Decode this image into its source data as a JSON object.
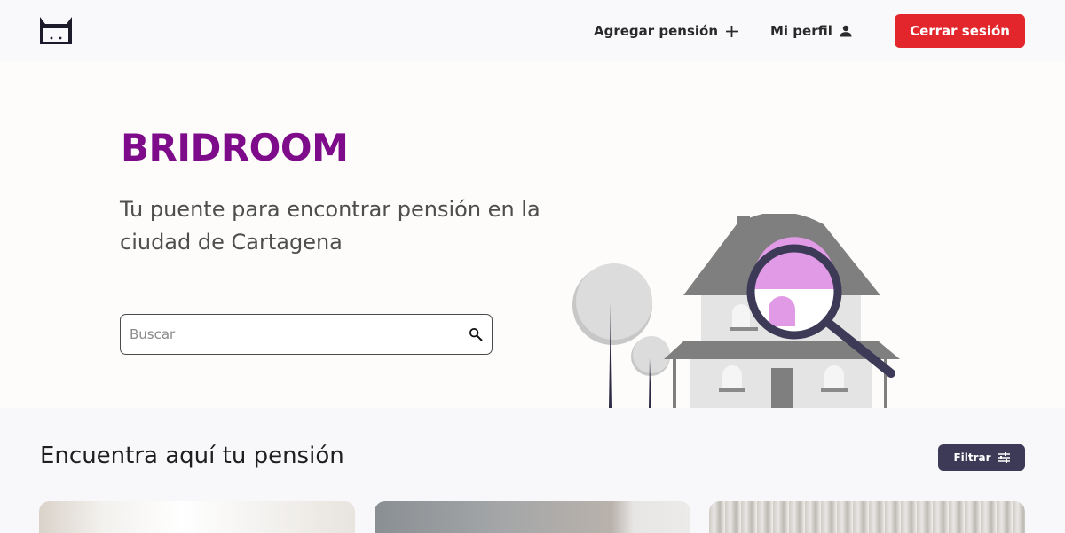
{
  "navbar": {
    "logo_icon": "cat-logo-icon",
    "add_label": "Agregar pensión",
    "add_icon": "plus-icon",
    "profile_label": "Mi perfil",
    "profile_icon": "user-icon",
    "logout_label": "Cerrar sesión"
  },
  "hero": {
    "brand": "BRIDROOM",
    "tagline": "Tu puente para encontrar pensión en la ciudad de Cartagena",
    "search_placeholder": "Buscar",
    "search_icon": "search-icon",
    "illustration": "house-search-illustration"
  },
  "listings": {
    "title": "Encuentra aquí tu pensión",
    "filter_label": "Filtrar",
    "filter_icon": "sliders-icon"
  },
  "colors": {
    "brand": "#7d0b8a",
    "logout": "#e3262b",
    "filter": "#3d3a57"
  }
}
